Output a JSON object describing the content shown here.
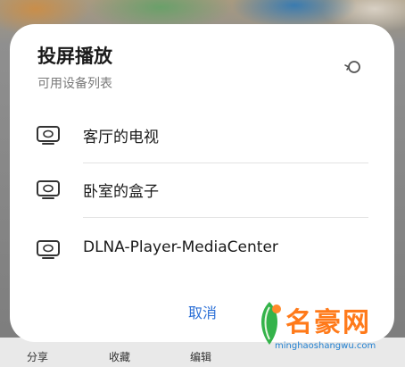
{
  "dialog": {
    "title": "投屏播放",
    "subtitle": "可用设备列表",
    "devices": [
      {
        "label": "客厅的电视",
        "icon": "tv-icon"
      },
      {
        "label": "卧室的盒子",
        "icon": "tv-icon"
      },
      {
        "label": "DLNA-Player-MediaCenter",
        "icon": "tv-icon"
      }
    ],
    "cancel_label": "取消",
    "refresh_icon": "refresh-icon"
  },
  "bottom_bar": {
    "items": [
      "分享",
      "收藏",
      "编辑"
    ]
  },
  "watermark": {
    "text": "名豪网",
    "url": "minghaoshangwu.com"
  },
  "colors": {
    "accent": "#2b6fd6",
    "watermark": "#ff7a1a",
    "watermark_sub": "#1f7fd0"
  }
}
